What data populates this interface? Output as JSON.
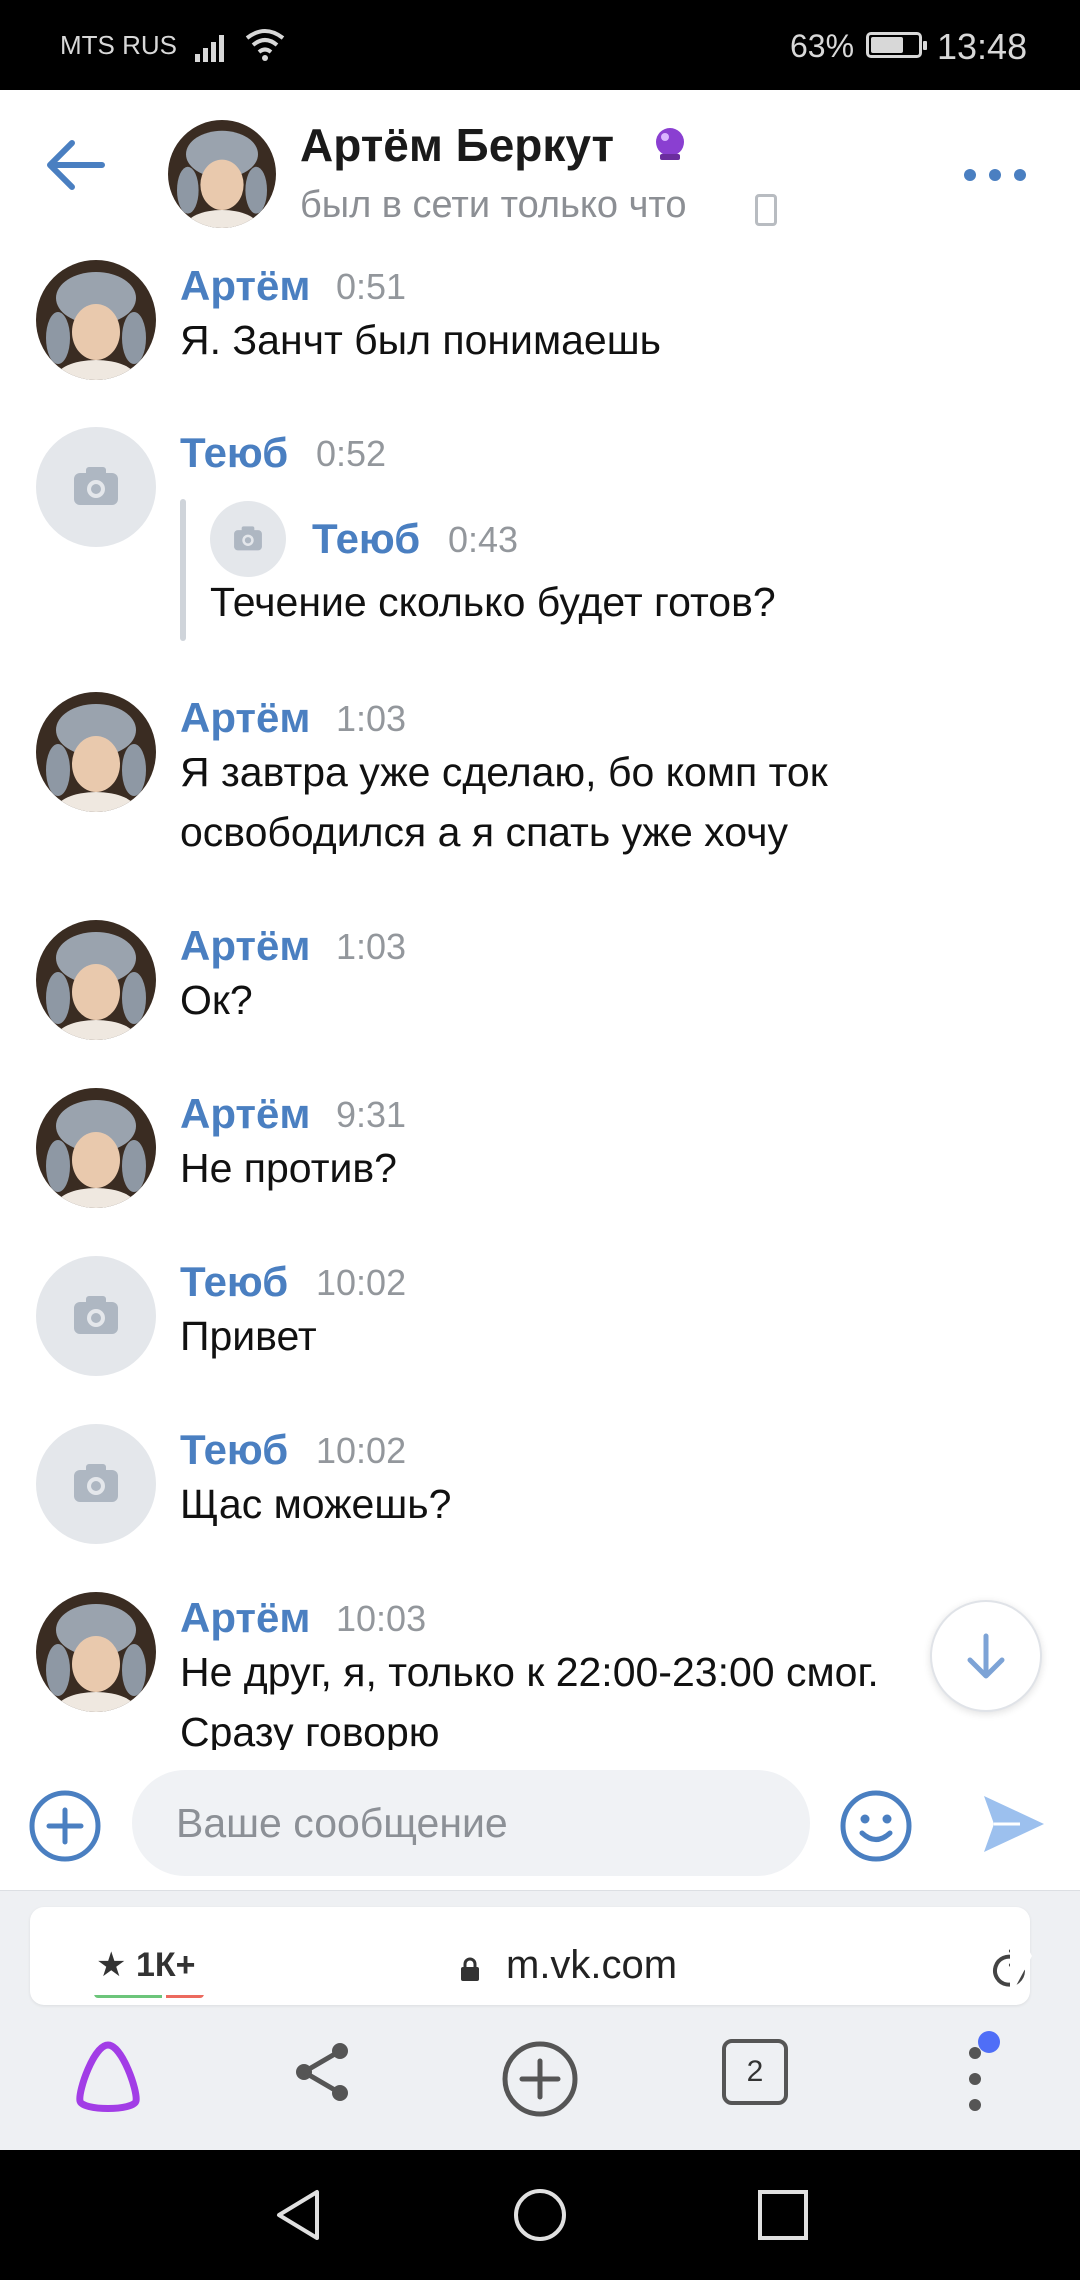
{
  "status_bar": {
    "carrier": "MTS RUS",
    "battery": "63%",
    "time": "13:48"
  },
  "header": {
    "name": "Артём Беркут",
    "status": "был в сети только что"
  },
  "messages": [
    {
      "author": "Артём",
      "time": "0:51",
      "text": "Я. Занчт был понимаешь",
      "avatar": "photo"
    },
    {
      "author": "Теюб",
      "time": "0:52",
      "avatar": "placeholder",
      "quote": {
        "author": "Теюб",
        "time": "0:43",
        "text": "Течение сколько будет готов?"
      }
    },
    {
      "author": "Артём",
      "time": "1:03",
      "text_lines": [
        "Я завтра уже сделаю, бо комп ток",
        "освободился а я спать уже хочу"
      ],
      "avatar": "photo"
    },
    {
      "author": "Артём",
      "time": "1:03",
      "text": "Ок?",
      "avatar": "photo"
    },
    {
      "author": "Артём",
      "time": "9:31",
      "text": "Не против?",
      "avatar": "photo"
    },
    {
      "author": "Теюб",
      "time": "10:02",
      "text": "Привет",
      "avatar": "placeholder"
    },
    {
      "author": "Теюб",
      "time": "10:02",
      "text": "Щас можешь?",
      "avatar": "placeholder"
    },
    {
      "author": "Артём",
      "time": "10:03",
      "text_lines": [
        "Не друг, я, только к 22:00-23:00 смог.",
        "Сразу говорю"
      ],
      "avatar": "photo"
    }
  ],
  "composer": {
    "placeholder": "Ваше сообщение"
  },
  "browser": {
    "rating": "1К+",
    "url": "m.vk.com",
    "tabs_count": "2"
  },
  "colors": {
    "accent": "#4a7fc1",
    "send_icon": "#9cc0ee",
    "alice": "#a23de6"
  }
}
